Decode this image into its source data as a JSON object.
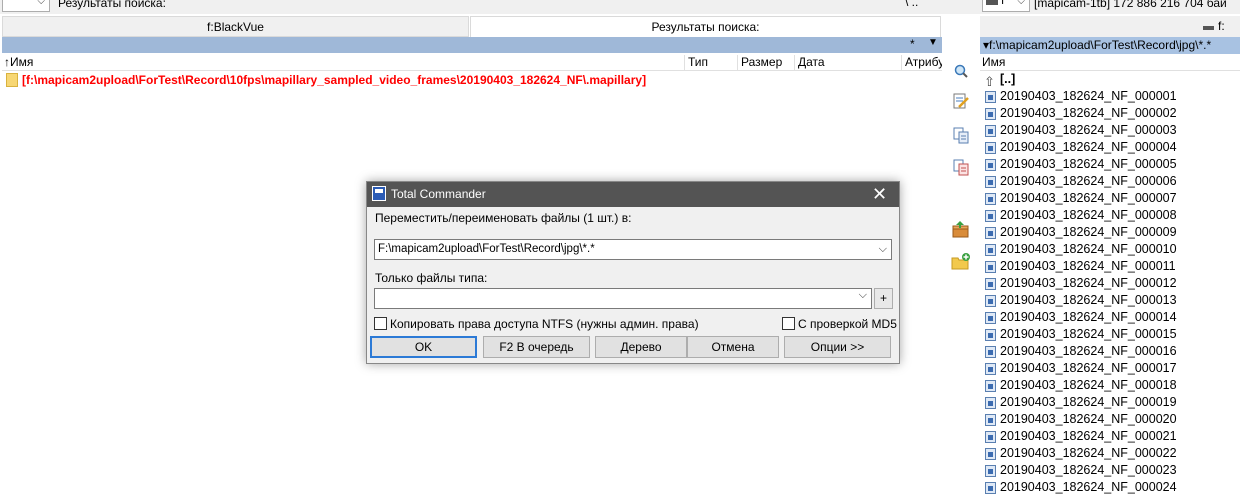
{
  "top_strip": {
    "left_drive_chevron": "⌵",
    "search_title": "Результаты поиска:",
    "path_sep": "\\ ..",
    "right_drive_letter": "f",
    "right_drive_chevron": "⌵",
    "volume_info": "[mapicam-1tb]  172 886 216 704 бай"
  },
  "left_panel": {
    "tabs": [
      {
        "label": "f:BlackVue"
      },
      {
        "label": "Результаты поиска:"
      }
    ],
    "pathbar": {
      "star": "*",
      "arrow": "▼"
    },
    "columns": {
      "name": "↑Имя",
      "type": "Тип",
      "size": "Размер",
      "date": "Дата",
      "attr": "Атрибу"
    },
    "rows": [
      {
        "path": "[f:\\mapicam2upload\\ForTest\\Record\\10fps\\mapillary_sampled_video_frames\\20190403_182624_NF\\.mapillary]"
      }
    ]
  },
  "toolbar": {
    "icons": [
      "magnify-icon",
      "edit-icon",
      "copy-icon",
      "compare-icon",
      "pack-icon",
      "new-folder-icon"
    ]
  },
  "right_panel": {
    "drive_label": "f:",
    "path": "▾f:\\mapicam2upload\\ForTest\\Record\\jpg\\*.*",
    "column_name": "Имя",
    "up_entry": "[..]",
    "files": [
      "20190403_182624_NF_000001",
      "20190403_182624_NF_000002",
      "20190403_182624_NF_000003",
      "20190403_182624_NF_000004",
      "20190403_182624_NF_000005",
      "20190403_182624_NF_000006",
      "20190403_182624_NF_000007",
      "20190403_182624_NF_000008",
      "20190403_182624_NF_000009",
      "20190403_182624_NF_000010",
      "20190403_182624_NF_000011",
      "20190403_182624_NF_000012",
      "20190403_182624_NF_000013",
      "20190403_182624_NF_000014",
      "20190403_182624_NF_000015",
      "20190403_182624_NF_000016",
      "20190403_182624_NF_000017",
      "20190403_182624_NF_000018",
      "20190403_182624_NF_000019",
      "20190403_182624_NF_000020",
      "20190403_182624_NF_000021",
      "20190403_182624_NF_000022",
      "20190403_182624_NF_000023",
      "20190403_182624_NF_000024"
    ]
  },
  "dialog": {
    "title": "Total Commander",
    "close": "✕",
    "move_label": "Переместить/переименовать файлы (1 шт.) в:",
    "target_value": "F:\\mapicam2upload\\ForTest\\Record\\jpg\\*.*",
    "filter_label": "Только файлы типа:",
    "filter_value": "",
    "plus": "+",
    "chk_ntfs": "Копировать права доступа NTFS (нужны админ. права)",
    "chk_md5": "С проверкой MD5",
    "buttons": {
      "ok": "OK",
      "queue": "F2 В очередь",
      "tree": "Дерево",
      "cancel": "Отмена",
      "options": "Опции >>"
    }
  }
}
